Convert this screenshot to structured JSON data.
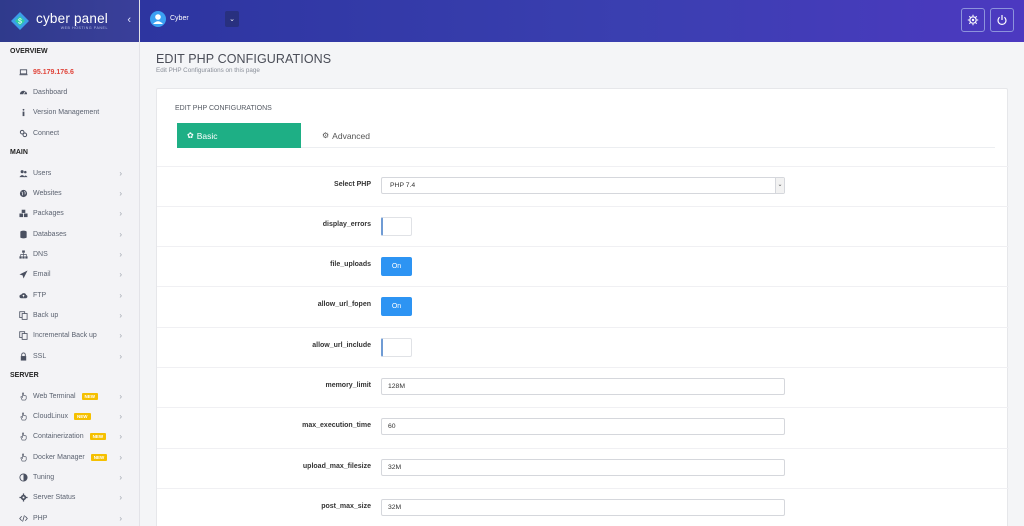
{
  "brand": {
    "name": "cyber panel",
    "tagline": "WEB HOSTING PANEL"
  },
  "topbar": {
    "user": "Cyber"
  },
  "sidebar": {
    "overview_title": "OVERVIEW",
    "main_title": "MAIN",
    "server_title": "SERVER",
    "overview": [
      {
        "label": "95.179.176.6",
        "icon": "laptop-icon"
      },
      {
        "label": "Dashboard",
        "icon": "dashboard-icon"
      },
      {
        "label": "Version Management",
        "icon": "info-icon"
      },
      {
        "label": "Connect",
        "icon": "link-icon"
      }
    ],
    "main": [
      {
        "label": "Users",
        "icon": "users-icon"
      },
      {
        "label": "Websites",
        "icon": "globe-icon"
      },
      {
        "label": "Packages",
        "icon": "packages-icon"
      },
      {
        "label": "Databases",
        "icon": "database-icon"
      },
      {
        "label": "DNS",
        "icon": "sitemap-icon"
      },
      {
        "label": "Email",
        "icon": "paper-plane-icon"
      },
      {
        "label": "FTP",
        "icon": "cloud-upload-icon"
      },
      {
        "label": "Back up",
        "icon": "copy-icon"
      },
      {
        "label": "Incremental Back up",
        "icon": "copy-icon"
      },
      {
        "label": "SSL",
        "icon": "lock-icon"
      }
    ],
    "server": [
      {
        "label": "Web Terminal",
        "icon": "hand-pointer-icon",
        "badge": "NEW"
      },
      {
        "label": "CloudLinux",
        "icon": "hand-pointer-icon",
        "badge": "NEW"
      },
      {
        "label": "Containerization",
        "icon": "hand-pointer-icon",
        "badge": "NEW"
      },
      {
        "label": "Docker Manager",
        "icon": "hand-pointer-icon",
        "badge": "NEW"
      },
      {
        "label": "Tuning",
        "icon": "adjust-icon"
      },
      {
        "label": "Server Status",
        "icon": "cog-icon"
      },
      {
        "label": "PHP",
        "icon": "code-icon"
      }
    ]
  },
  "page": {
    "title": "EDIT PHP CONFIGURATIONS",
    "subtitle": "Edit PHP Configurations on this page",
    "panel_title": "EDIT PHP CONFIGURATIONS"
  },
  "tabs": {
    "basic": "Basic",
    "advanced": "Advanced"
  },
  "form": {
    "select_php_label": "Select PHP",
    "select_php_value": "PHP 7.4",
    "display_errors_label": "display_errors",
    "file_uploads_label": "file_uploads",
    "file_uploads_state": "On",
    "allow_url_fopen_label": "allow_url_fopen",
    "allow_url_fopen_state": "On",
    "allow_url_include_label": "allow_url_include",
    "memory_limit_label": "memory_limit",
    "memory_limit_value": "128M",
    "max_execution_time_label": "max_execution_time",
    "max_execution_time_value": "60",
    "upload_max_filesize_label": "upload_max_filesize",
    "upload_max_filesize_value": "32M",
    "post_max_size_label": "post_max_size",
    "post_max_size_value": "32M"
  },
  "colors": {
    "accent": "#1eaf85",
    "toggle_on": "#2d94f3",
    "ip": "#e0443a",
    "topbar": "#2d35a0"
  }
}
